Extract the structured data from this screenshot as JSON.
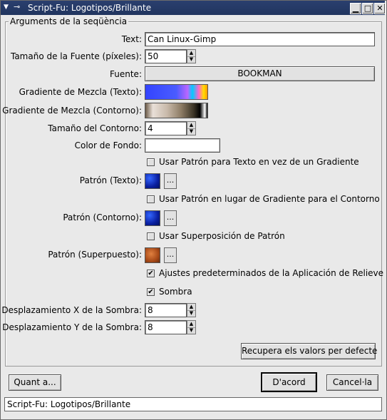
{
  "window": {
    "title": "Script-Fu: Logotipos/Brillante",
    "menu_icon": "window-menu-icon",
    "pin_icon": "pin-icon",
    "minimize_icon": "minimize-icon",
    "maximize_icon": "maximize-icon",
    "close_icon": "close-icon"
  },
  "frame_label": "Arguments de la seqüència",
  "fields": {
    "text_label": "Text:",
    "text_value": "Can Linux-Gimp",
    "font_size_label": "Tamaño de la Fuente (píxeles):",
    "font_size_value": "50",
    "font_label": "Fuente:",
    "font_value": "BOOKMAN",
    "blend_text_label": "Gradiente de Mezcla (Texto):",
    "blend_outline_label": "Gradiente de Mezcla (Contorno):",
    "outline_size_label": "Tamaño del Contorno:",
    "outline_size_value": "4",
    "bg_color_label": "Color de Fondo:",
    "bg_color": "#ffffff",
    "use_pattern_text_label": "Usar Patrón para Texto en vez de un Gradiente",
    "use_pattern_text_checked": false,
    "pattern_text_label": "Patrón (Texto):",
    "use_pattern_outline_label": "Usar Patrón en lugar de Gradiente para el Contorno",
    "use_pattern_outline_checked": false,
    "pattern_outline_label": "Patrón (Contorno):",
    "use_overlay_label": "Usar Superposición de Patrón",
    "use_overlay_checked": false,
    "pattern_overlay_label": "Patrón (Superpuesto):",
    "default_bump_label": "Ajustes predeterminados de la Aplicación de Relieve",
    "default_bump_checked": true,
    "shadow_label": "Sombra",
    "shadow_checked": true,
    "shadow_x_label": "Desplazamiento X de la Sombra:",
    "shadow_x_value": "8",
    "shadow_y_label": "Desplazamiento Y de la Sombra:",
    "shadow_y_value": "8",
    "browse_label": "...",
    "check_mark": "✔"
  },
  "buttons": {
    "reset": "Recupera els valors per defecte",
    "about": "Quant a...",
    "ok": "D'acord",
    "cancel": "Cancel·la"
  },
  "statusbar": "Script-Fu: Logotipos/Brillante"
}
